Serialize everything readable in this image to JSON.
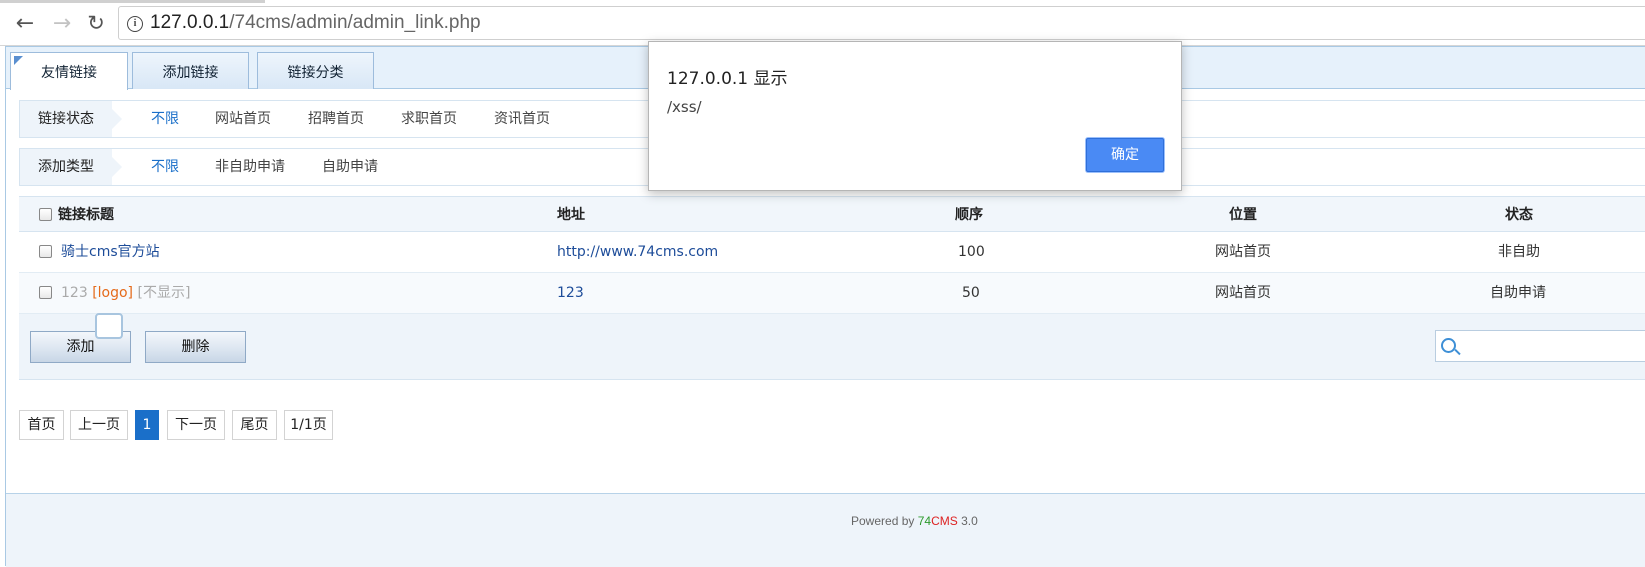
{
  "browser": {
    "url_host": "127.0.0.1",
    "url_path": "/74cms/admin/admin_link.php"
  },
  "tabs": [
    {
      "label": "友情链接"
    },
    {
      "label": "添加链接"
    },
    {
      "label": "链接分类"
    }
  ],
  "filters": {
    "status": {
      "label": "链接状态",
      "options": [
        "不限",
        "网站首页",
        "招聘首页",
        "求职首页",
        "资讯首页"
      ],
      "selected": "不限"
    },
    "type": {
      "label": "添加类型",
      "options": [
        "不限",
        "非自助申请",
        "自助申请"
      ],
      "selected": "不限"
    }
  },
  "table": {
    "headers": {
      "title": "链接标题",
      "url": "地址",
      "order": "顺序",
      "position": "位置",
      "status": "状态"
    },
    "rows": [
      {
        "title": "骑士cms官方站",
        "url": "http://www.74cms.com",
        "order": "100",
        "position": "网站首页",
        "status": "非自助"
      },
      {
        "title": "123",
        "logo_tag": "[logo]",
        "hidden_tag": "[不显示]",
        "url": "123",
        "order": "50",
        "position": "网站首页",
        "status": "自助申请"
      }
    ]
  },
  "actions": {
    "add": "添加",
    "delete": "删除"
  },
  "pager": {
    "first": "首页",
    "prev": "上一页",
    "current": "1",
    "next": "下一页",
    "last": "尾页",
    "summary": "1/1页"
  },
  "footer": {
    "prefix": "Powered by ",
    "brand_a": "74",
    "brand_b": "CMS",
    "version": " 3.0"
  },
  "dialog": {
    "title": "127.0.0.1 显示",
    "message": "/xss/",
    "ok": "确定"
  },
  "colors": {
    "accent": "#1a6fc9",
    "dialog_button": "#4a8af4"
  }
}
